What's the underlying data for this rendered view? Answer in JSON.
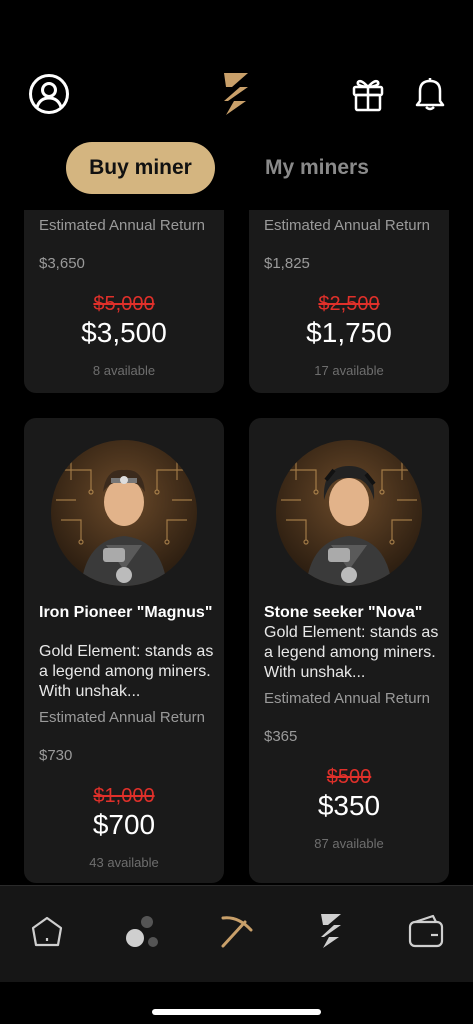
{
  "header": {
    "profile_icon": "user-circle-icon",
    "logo_icon": "brand-logo-icon",
    "gift_icon": "gift-icon",
    "bell_icon": "bell-icon"
  },
  "tabs": {
    "buy_label": "Buy miner",
    "mine_label": "My miners"
  },
  "cards": [
    {
      "return_label": "Estimated Annual Return",
      "return_value": "$3,650",
      "old_price": "$5,000",
      "price": "$3,500",
      "available": "8 available"
    },
    {
      "return_label": "Estimated Annual Return",
      "return_value": "$1,825",
      "old_price": "$2,500",
      "price": "$1,750",
      "available": "17 available"
    },
    {
      "name": "Iron Pioneer \"Magnus\"",
      "description": "Gold Element: stands as a legend among miners. With unshak...",
      "return_label": "Estimated Annual Return",
      "return_value": "$730",
      "old_price": "$1,000",
      "price": "$700",
      "available": "43 available"
    },
    {
      "name": "Stone seeker \"Nova\"",
      "description": "Gold Element: stands as a legend among miners. With unshak...",
      "return_label": "Estimated Annual Return",
      "return_value": "$365",
      "old_price": "$500",
      "price": "$350",
      "available": "87 available"
    }
  ],
  "nav": {
    "items": [
      "home-icon",
      "community-icon",
      "pickaxe-icon",
      "brand-logo-icon",
      "wallet-icon"
    ],
    "active": "pickaxe-icon"
  },
  "colors": {
    "accent": "#d4b580",
    "strike": "#e0302a",
    "card_bg": "#1a1a1a"
  }
}
